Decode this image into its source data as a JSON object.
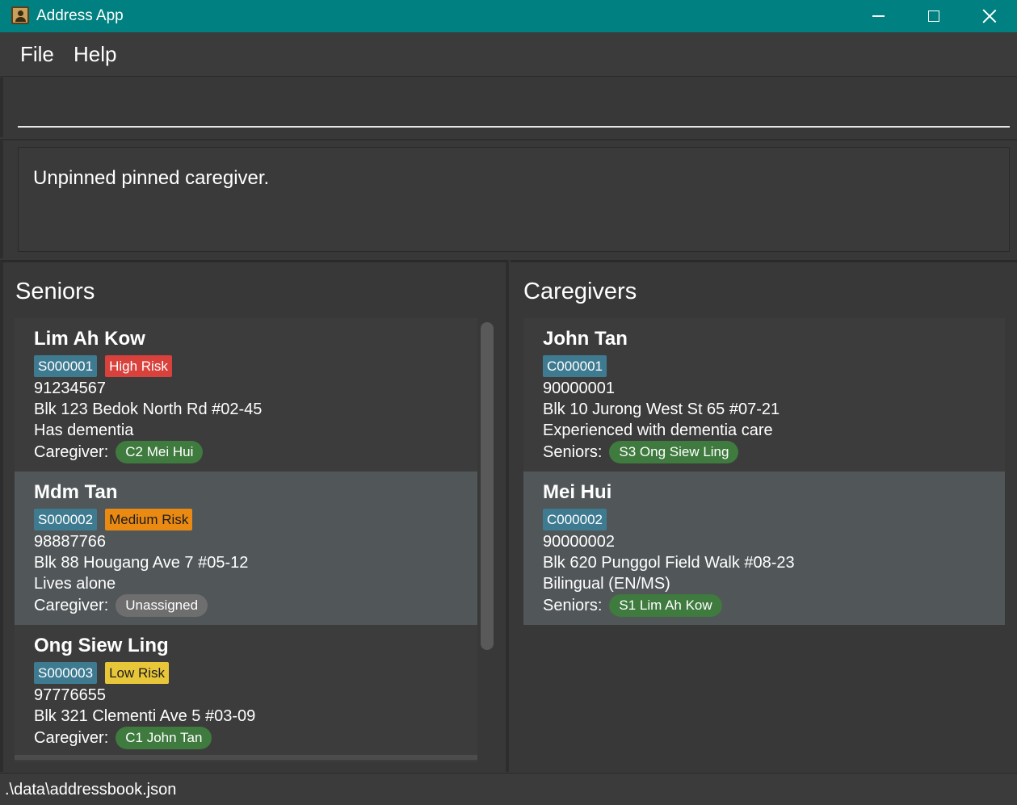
{
  "window": {
    "title": "Address App",
    "icons": {
      "app": "address-book-icon",
      "minimize": "minimize-icon",
      "maximize": "maximize-icon",
      "close": "close-icon"
    }
  },
  "menu": {
    "file": "File",
    "help": "Help"
  },
  "command": {
    "value": ""
  },
  "result": {
    "text": "Unpinned pinned caregiver."
  },
  "seniors": {
    "title": "Seniors",
    "items": [
      {
        "name": "Lim Ah Kow",
        "id": "S000001",
        "risk": "High Risk",
        "phone": "91234567",
        "address": "Blk 123 Bedok North Rd #02-45",
        "note": "Has dementia",
        "assoc_label": "Caregiver:",
        "assoc": "C2 Mei Hui"
      },
      {
        "name": "Mdm Tan",
        "id": "S000002",
        "risk": "Medium Risk",
        "phone": "98887766",
        "address": "Blk 88 Hougang Ave 7 #05-12",
        "note": "Lives alone",
        "assoc_label": "Caregiver:",
        "assoc": "Unassigned"
      },
      {
        "name": "Ong Siew Ling",
        "id": "S000003",
        "risk": "Low Risk",
        "phone": "97776655",
        "address": "Blk 321 Clementi Ave 5 #03-09",
        "assoc_label": "Caregiver:",
        "assoc": "C1 John Tan"
      }
    ]
  },
  "caregivers": {
    "title": "Caregivers",
    "items": [
      {
        "name": "John Tan",
        "id": "C000001",
        "phone": "90000001",
        "address": "Blk 10 Jurong West St 65 #07-21",
        "note": "Experienced with dementia care",
        "assoc_label": "Seniors:",
        "assoc": "S3 Ong Siew Ling"
      },
      {
        "name": "Mei Hui",
        "id": "C000002",
        "phone": "90000002",
        "address": "Blk 620 Punggol Field Walk #08-23",
        "note": "Bilingual (EN/MS)",
        "assoc_label": "Seniors:",
        "assoc": "S1 Lim Ah Kow"
      }
    ]
  },
  "status": {
    "path": ".\\data\\addressbook.json"
  },
  "colors": {
    "title_bar": "#008080",
    "id_tag": "#3e7b91",
    "high_risk": "#d9413c",
    "medium_risk": "#ea8a12",
    "low_risk": "#e8c63a",
    "assigned_pill": "#3f7a3e",
    "unassigned_pill": "#6e6e6e"
  }
}
